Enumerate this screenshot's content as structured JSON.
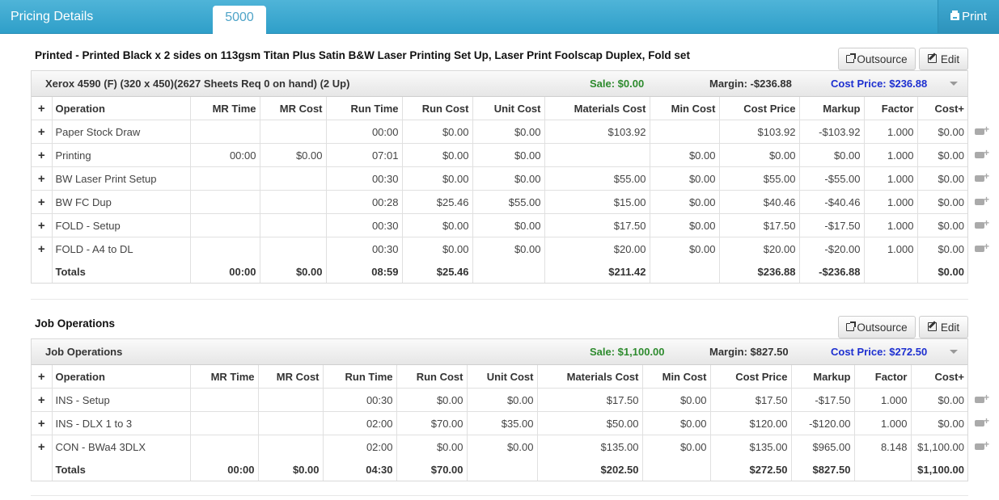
{
  "header": {
    "title": "Pricing Details",
    "tab": "5000",
    "print": "Print"
  },
  "sections": [
    {
      "title": "Printed - Printed Black x 2 sides on 113gsm Titan Plus Satin B&W Laser Printing Set Up, Laser Print Foolscap Duplex, Fold set",
      "outsource": "Outsource",
      "edit": "Edit",
      "head": {
        "name": "Xerox 4590 (F) (320 x 450)(2627 Sheets Req 0 on hand) (2 Up)",
        "sale": "Sale: $0.00",
        "margin": "Margin: -$236.88",
        "cost": "Cost Price: $236.88"
      },
      "columns": [
        "Operation",
        "MR Time",
        "MR Cost",
        "Run Time",
        "Run Cost",
        "Unit Cost",
        "Materials Cost",
        "Min Cost",
        "Cost Price",
        "Markup",
        "Factor",
        "Cost+"
      ],
      "rows": [
        [
          "Paper Stock Draw",
          "",
          "",
          "00:00",
          "$0.00",
          "$0.00",
          "$103.92",
          "",
          "$103.92",
          "-$103.92",
          "1.000",
          "$0.00"
        ],
        [
          "Printing",
          "00:00",
          "$0.00",
          "07:01",
          "$0.00",
          "$0.00",
          "",
          "$0.00",
          "$0.00",
          "$0.00",
          "1.000",
          "$0.00"
        ],
        [
          "BW Laser Print Setup",
          "",
          "",
          "00:30",
          "$0.00",
          "$0.00",
          "$55.00",
          "$0.00",
          "$55.00",
          "-$55.00",
          "1.000",
          "$0.00"
        ],
        [
          "BW FC Dup",
          "",
          "",
          "00:28",
          "$25.46",
          "$55.00",
          "$15.00",
          "$0.00",
          "$40.46",
          "-$40.46",
          "1.000",
          "$0.00"
        ],
        [
          "FOLD - Setup",
          "",
          "",
          "00:30",
          "$0.00",
          "$0.00",
          "$17.50",
          "$0.00",
          "$17.50",
          "-$17.50",
          "1.000",
          "$0.00"
        ],
        [
          "FOLD - A4 to DL",
          "",
          "",
          "00:30",
          "$0.00",
          "$0.00",
          "$20.00",
          "$0.00",
          "$20.00",
          "-$20.00",
          "1.000",
          "$0.00"
        ]
      ],
      "totals": [
        "Totals",
        "00:00",
        "$0.00",
        "08:59",
        "$25.46",
        "",
        "$211.42",
        "",
        "$236.88",
        "-$236.88",
        "",
        "$0.00"
      ]
    },
    {
      "title": "Job Operations",
      "outsource": "Outsource",
      "edit": "Edit",
      "head": {
        "name": "Job Operations",
        "sale": "Sale: $1,100.00",
        "margin": "Margin: $827.50",
        "cost": "Cost Price: $272.50"
      },
      "columns": [
        "Operation",
        "MR Time",
        "MR Cost",
        "Run Time",
        "Run Cost",
        "Unit Cost",
        "Materials Cost",
        "Min Cost",
        "Cost Price",
        "Markup",
        "Factor",
        "Cost+"
      ],
      "rows": [
        [
          "INS - Setup",
          "",
          "",
          "00:30",
          "$0.00",
          "$0.00",
          "$17.50",
          "$0.00",
          "$17.50",
          "-$17.50",
          "1.000",
          "$0.00"
        ],
        [
          "INS - DLX 1 to 3",
          "",
          "",
          "02:00",
          "$70.00",
          "$35.00",
          "$50.00",
          "$0.00",
          "$120.00",
          "-$120.00",
          "1.000",
          "$0.00"
        ],
        [
          "CON - BWa4 3DLX",
          "",
          "",
          "02:00",
          "$0.00",
          "$0.00",
          "$135.00",
          "$0.00",
          "$135.00",
          "$965.00",
          "8.148",
          "$1,100.00"
        ]
      ],
      "totals": [
        "Totals",
        "00:00",
        "$0.00",
        "04:30",
        "$70.00",
        "",
        "$202.50",
        "",
        "$272.50",
        "$827.50",
        "",
        "$1,100.00"
      ]
    }
  ],
  "colors": {
    "header_bar": "#3aa8d2",
    "sale": "#2e8b2e",
    "cost_price": "#1d2fd0"
  }
}
